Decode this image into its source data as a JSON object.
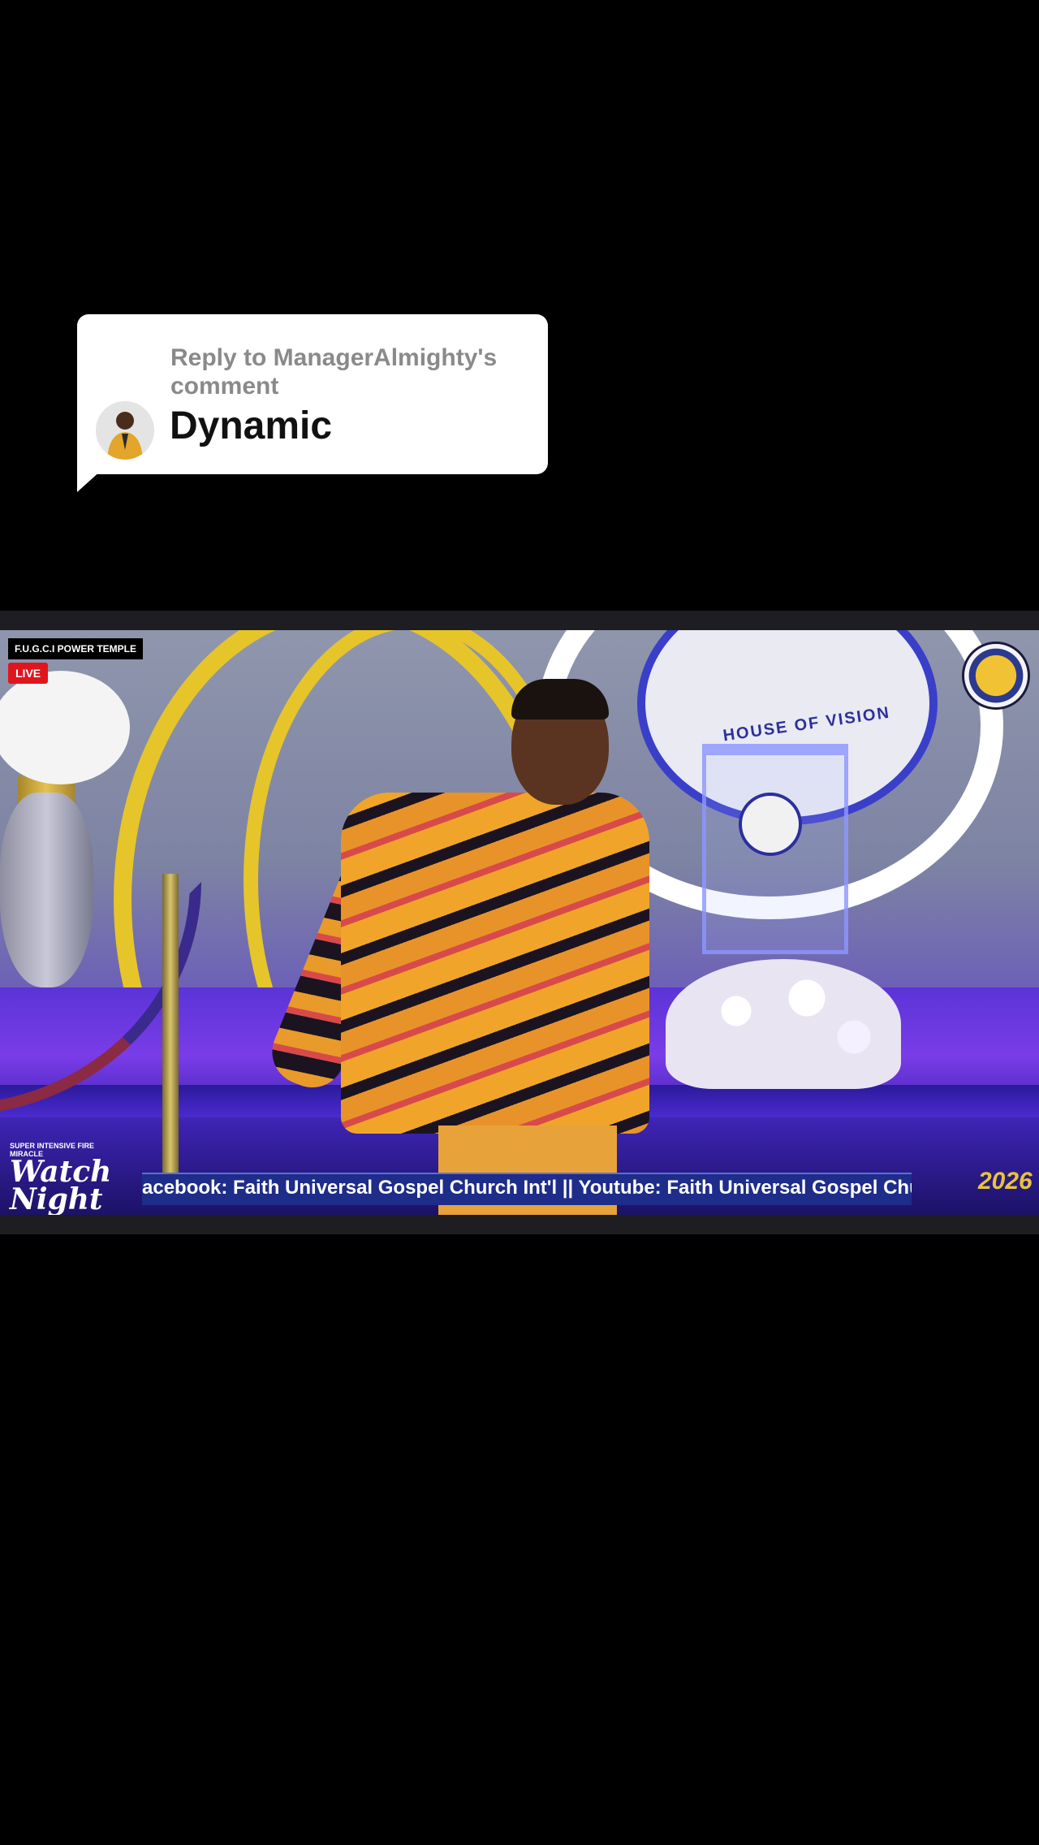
{
  "reply": {
    "label": "Reply to ManagerAlmighty's comment",
    "text": "Dynamic"
  },
  "video": {
    "channel_tag": "F.U.G.C.I POWER TEMPLE",
    "live_label": "LIVE",
    "emblem_text": "HOUSE OF VISION",
    "event_super": "SUPER INTENSIVE FIRE MIRACLE",
    "event_line1": "Watch",
    "event_line2": "Night",
    "ticker": "acebook: Faith Universal Gospel Church Int'l  ||  Youtube: Faith Universal Gospel Churc",
    "year": "2026"
  },
  "colors": {
    "live": "#e0161e",
    "ticker_bg": "#1e2c8a",
    "accent_gold": "#e8c33a"
  }
}
